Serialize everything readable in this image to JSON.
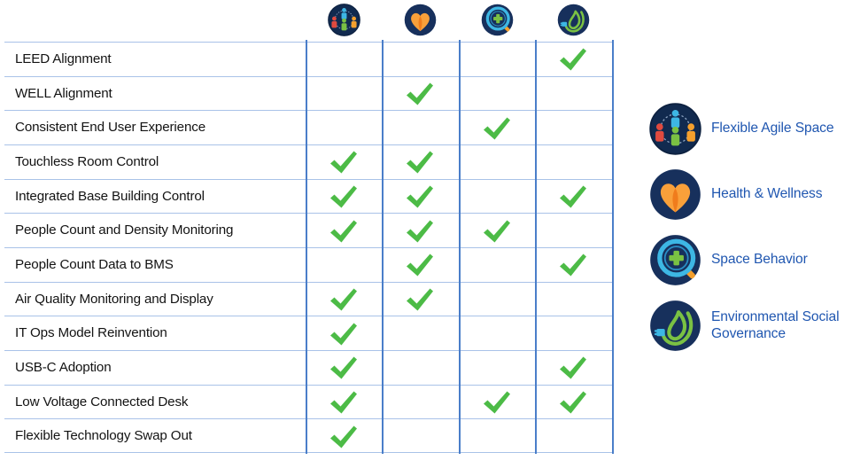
{
  "matrix": {
    "columns": [
      {
        "id": "flexible-agile-space",
        "icon": "flexible-agile-space-icon",
        "label": "Flexible Agile Space"
      },
      {
        "id": "health-wellness",
        "icon": "health-wellness-icon",
        "label": "Health & Wellness"
      },
      {
        "id": "space-behavior",
        "icon": "space-behavior-icon",
        "label": "Space Behavior"
      },
      {
        "id": "environmental-social-governance",
        "icon": "environmental-social-governance-icon",
        "label": "Environmental Social Governance"
      }
    ],
    "rows": [
      {
        "label": "LEED Alignment",
        "marks": [
          0,
          0,
          0,
          1
        ]
      },
      {
        "label": "WELL Alignment",
        "marks": [
          0,
          1,
          0,
          0
        ]
      },
      {
        "label": "Consistent End User Experience",
        "marks": [
          0,
          0,
          1,
          0
        ]
      },
      {
        "label": "Touchless Room Control",
        "marks": [
          1,
          1,
          0,
          0
        ]
      },
      {
        "label": "Integrated Base Building Control",
        "marks": [
          1,
          1,
          0,
          1
        ]
      },
      {
        "label": "People Count and Density Monitoring",
        "marks": [
          1,
          1,
          1,
          0
        ]
      },
      {
        "label": "People Count Data to BMS",
        "marks": [
          0,
          1,
          0,
          1
        ]
      },
      {
        "label": "Air Quality Monitoring and Display",
        "marks": [
          1,
          1,
          0,
          0
        ]
      },
      {
        "label": "IT Ops Model Reinvention",
        "marks": [
          1,
          0,
          0,
          0
        ]
      },
      {
        "label": "USB-C Adoption",
        "marks": [
          1,
          0,
          0,
          1
        ]
      },
      {
        "label": "Low Voltage Connected Desk",
        "marks": [
          1,
          0,
          1,
          1
        ]
      },
      {
        "label": "Flexible Technology Swap Out",
        "marks": [
          1,
          0,
          0,
          0
        ]
      }
    ],
    "mark_symbol": "check-mark-icon"
  },
  "legend": {
    "items": [
      {
        "icon": "flexible-agile-space-icon",
        "label": "Flexible Agile Space",
        "line1": "Flexible Agile Space",
        "line2": ""
      },
      {
        "icon": "health-wellness-icon",
        "label": "Health & Wellness",
        "line1": "Health & Wellness",
        "line2": ""
      },
      {
        "icon": "space-behavior-icon",
        "label": "Space Behavior",
        "line1": "Space Behavior",
        "line2": ""
      },
      {
        "icon": "environmental-social-governance-icon",
        "label": "Environmental Social Governance",
        "line1": "Environmental Social",
        "line2": "Governance"
      }
    ]
  },
  "colors": {
    "check_green": "#4cbb46",
    "grid_line_blue": "#a9c2e8",
    "column_line_blue": "#4a7ec9",
    "legend_text_blue": "#1f56b0",
    "icon_navy": "#17305c",
    "accent_orange": "#f5a02d",
    "accent_green": "#7ac143",
    "accent_lightblue": "#3db7e4",
    "accent_red": "#e04a3f"
  }
}
